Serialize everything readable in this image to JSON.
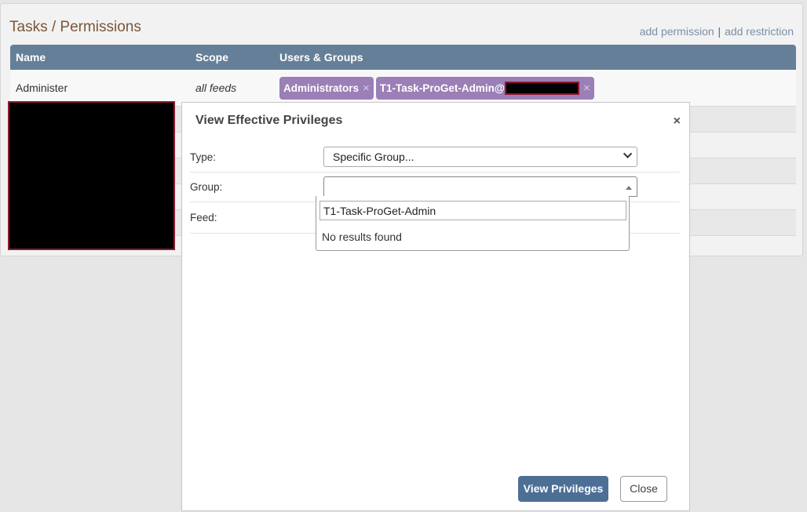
{
  "page": {
    "title": "Tasks / Permissions",
    "links": {
      "add_permission": "add permission",
      "separator": "|",
      "add_restriction": "add restriction"
    }
  },
  "table": {
    "columns": [
      "Name",
      "Scope",
      "Users & Groups"
    ],
    "rows": [
      {
        "name": "Administer",
        "scope": "all feeds",
        "tags": [
          {
            "label": "Administrators",
            "remove": "×"
          },
          {
            "label": "T1-Task-ProGet-Admin@",
            "remove": "×"
          }
        ]
      }
    ]
  },
  "modal": {
    "title": "View Effective Privileges",
    "close": "×",
    "type_label": "Type:",
    "type_value": "Specific Group...",
    "group_label": "Group:",
    "group_value": "",
    "feed_label": "Feed:",
    "search_value": "T1-Task-ProGet-Admin",
    "no_results": "No results found",
    "view_button": "View Privileges",
    "close_button": "Close"
  },
  "colors": {
    "header": "#667f99",
    "tag": "#9b7fb6",
    "primary_button": "#4d6f96",
    "title": "#7a5638"
  }
}
